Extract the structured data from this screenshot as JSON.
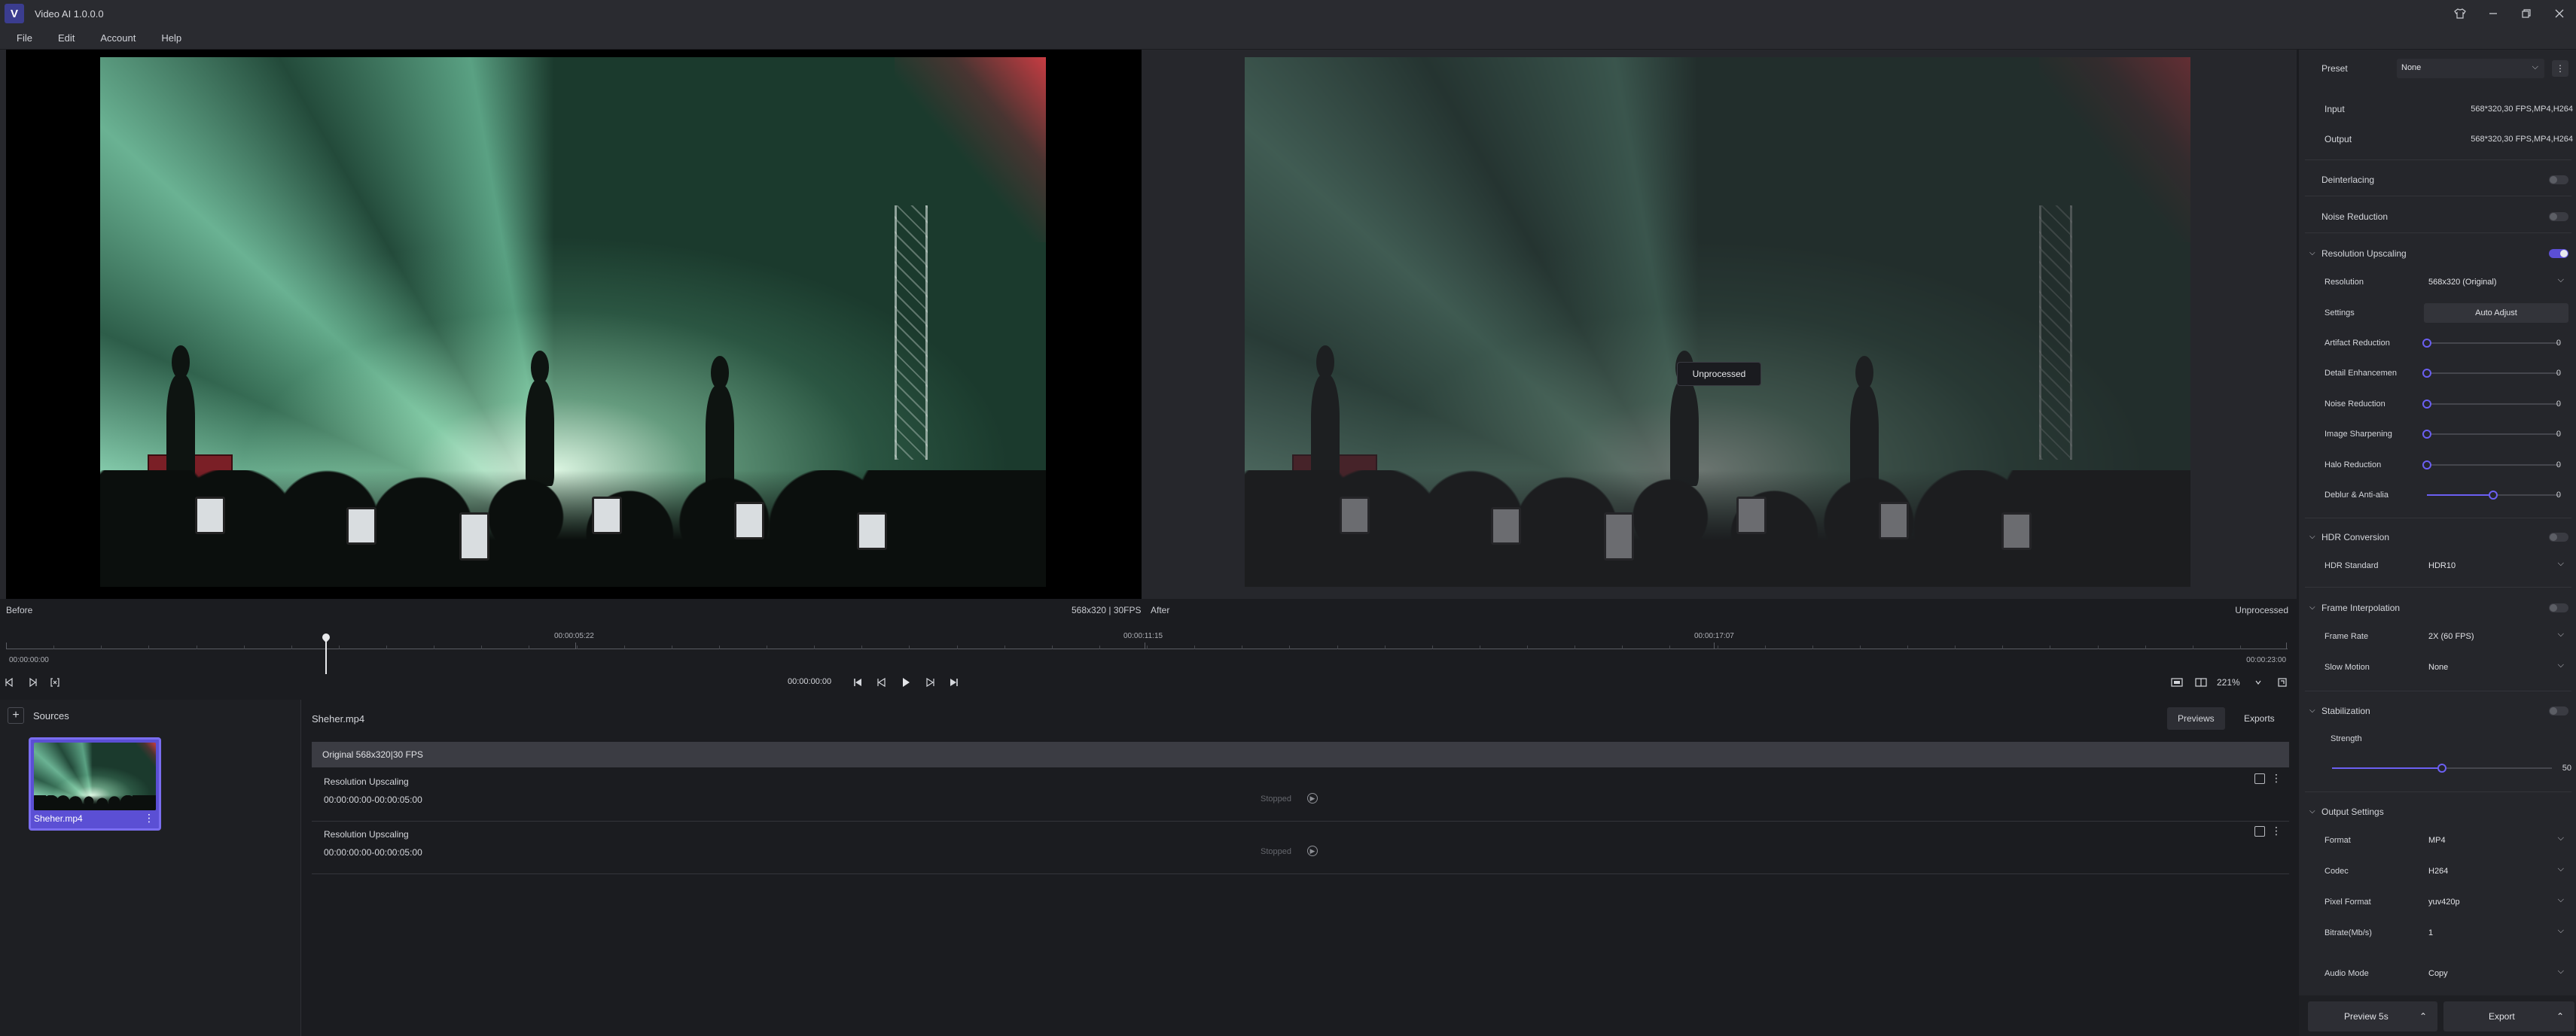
{
  "window": {
    "title": "Video AI 1.0.0.0",
    "logo_letter": "V"
  },
  "menu": [
    "File",
    "Edit",
    "Account",
    "Help"
  ],
  "preview": {
    "before_label": "Before",
    "info": "568x320 | 30FPS",
    "after_label": "After",
    "after_status": "Unprocessed",
    "badge": "Unprocessed"
  },
  "timeline": {
    "start": "00:00:00:00",
    "marks": [
      "00:00:05:22",
      "00:00:11:15",
      "00:00:17:07"
    ],
    "end": "00:00:23:00",
    "playhead_fraction": 0.14
  },
  "transport": {
    "timecode": "00:00:00:00",
    "zoom": "221%"
  },
  "sources": {
    "title": "Sources",
    "items": [
      {
        "name": "Sheher.mp4"
      }
    ]
  },
  "clips": {
    "file": "Sheher.mp4",
    "tabs": [
      "Previews",
      "Exports"
    ],
    "original": "Original 568x320|30 FPS",
    "rows": [
      {
        "title": "Resolution Upscaling",
        "range": "00:00:00:00-00:00:05:00",
        "status": "Stopped"
      },
      {
        "title": "Resolution Upscaling",
        "range": "00:00:00:00-00:00:05:00",
        "status": "Stopped"
      }
    ]
  },
  "panel": {
    "preset_label": "Preset",
    "preset_value": "None",
    "input_label": "Input",
    "input_value": "568*320,30 FPS,MP4,H264",
    "output_label": "Output",
    "output_value": "568*320,30 FPS,MP4,H264",
    "deinterlacing": {
      "label": "Deinterlacing",
      "on": false
    },
    "noise_reduction": {
      "label": "Noise Reduction",
      "on": false
    },
    "upscaling": {
      "label": "Resolution Upscaling",
      "on": true,
      "resolution_label": "Resolution",
      "resolution_value": "568x320 (Original)",
      "settings_label": "Settings",
      "auto_adjust": "Auto Adjust",
      "sliders": [
        {
          "label": "Artifact Reduction",
          "value": "0",
          "fraction": 0.0
        },
        {
          "label": "Detail Enhancement",
          "value": "0",
          "fraction": 0.0
        },
        {
          "label": "Noise Reduction",
          "value": "0",
          "fraction": 0.0
        },
        {
          "label": "Image Sharpening",
          "value": "0",
          "fraction": 0.0
        },
        {
          "label": "Halo Reduction",
          "value": "0",
          "fraction": 0.0
        },
        {
          "label": "Deblur & Anti-alia",
          "value": "0",
          "fraction": 0.5
        }
      ]
    },
    "hdr": {
      "label": "HDR Conversion",
      "on": false,
      "standard_label": "HDR Standard",
      "standard_value": "HDR10"
    },
    "interp": {
      "label": "Frame Interpolation",
      "on": false,
      "rate_label": "Frame Rate",
      "rate_value": "2X (60 FPS)",
      "slow_label": "Slow Motion",
      "slow_value": "None"
    },
    "stab": {
      "label": "Stabilization",
      "on": false,
      "strength_label": "Strength",
      "strength_value": "50",
      "strength_fraction": 0.5
    },
    "output": {
      "label": "Output Settings",
      "rows": [
        {
          "label": "Format",
          "value": "MP4"
        },
        {
          "label": "Codec",
          "value": "H264"
        },
        {
          "label": "Pixel Format",
          "value": "yuv420p"
        },
        {
          "label": "Bitrate(Mb/s)",
          "value": "1"
        },
        {
          "label": "Audio Mode",
          "value": "Copy"
        }
      ]
    },
    "preview_btn": "Preview 5s",
    "export_btn": "Export"
  }
}
